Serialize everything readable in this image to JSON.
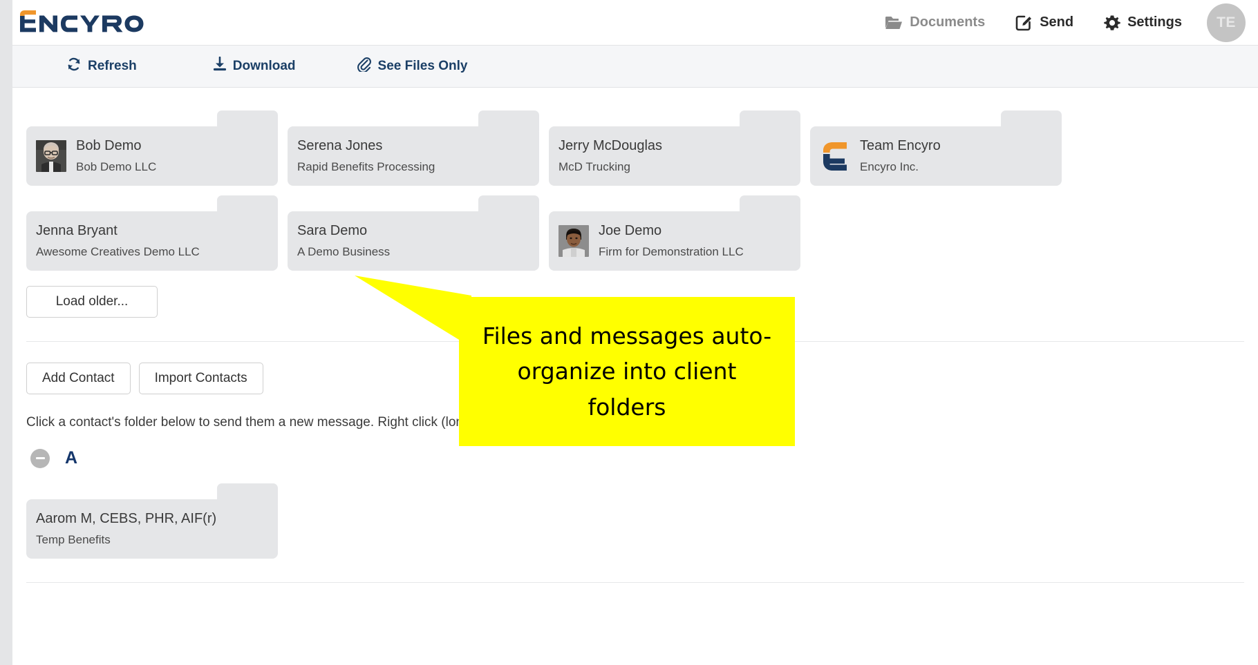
{
  "header": {
    "logo_text": "ENCYRO",
    "logo_colors": {
      "accent": "#f0962b",
      "main": "#1c3a61"
    },
    "nav": [
      {
        "label": "Documents",
        "icon": "folder-icon",
        "state": "muted"
      },
      {
        "label": "Send",
        "icon": "compose-icon",
        "state": "active"
      },
      {
        "label": "Settings",
        "icon": "gear-icon",
        "state": "active"
      }
    ],
    "avatar_initials": "TE"
  },
  "toolbar": [
    {
      "label": "Refresh",
      "icon": "refresh-icon"
    },
    {
      "label": "Download",
      "icon": "download-icon"
    },
    {
      "label": "See Files Only",
      "icon": "paperclip-icon"
    }
  ],
  "recent_folders": [
    {
      "name": "Bob Demo",
      "org": "Bob Demo LLC",
      "thumb": "photo"
    },
    {
      "name": "Serena Jones",
      "org": "Rapid Benefits Processing",
      "thumb": "none"
    },
    {
      "name": "Jerry McDouglas",
      "org": "McD Trucking",
      "thumb": "none"
    },
    {
      "name": "Team Encyro",
      "org": "Encyro Inc.",
      "thumb": "logo"
    },
    {
      "name": "Jenna Bryant",
      "org": "Awesome Creatives Demo LLC",
      "thumb": "none"
    },
    {
      "name": "Sara Demo",
      "org": "A Demo Business",
      "thumb": "none"
    },
    {
      "name": "Joe Demo",
      "org": "Firm for Demonstration LLC",
      "thumb": "photo"
    }
  ],
  "load_older_label": "Load older...",
  "actions": {
    "add_contact": "Add Contact",
    "import_contacts": "Import Contacts"
  },
  "hint": "Click a contact's folder below to send them a new message. Right click (lon",
  "alpha_section": {
    "letter": "A",
    "toggle_icon": "minus-circle-icon",
    "contacts": [
      {
        "name": "Aarom M, CEBS, PHR, AIF(r)",
        "org": "Temp Benefits",
        "thumb": "none"
      }
    ]
  },
  "callout": {
    "text": "Files and messages auto-organize into client folders",
    "color": "#ffff00"
  }
}
